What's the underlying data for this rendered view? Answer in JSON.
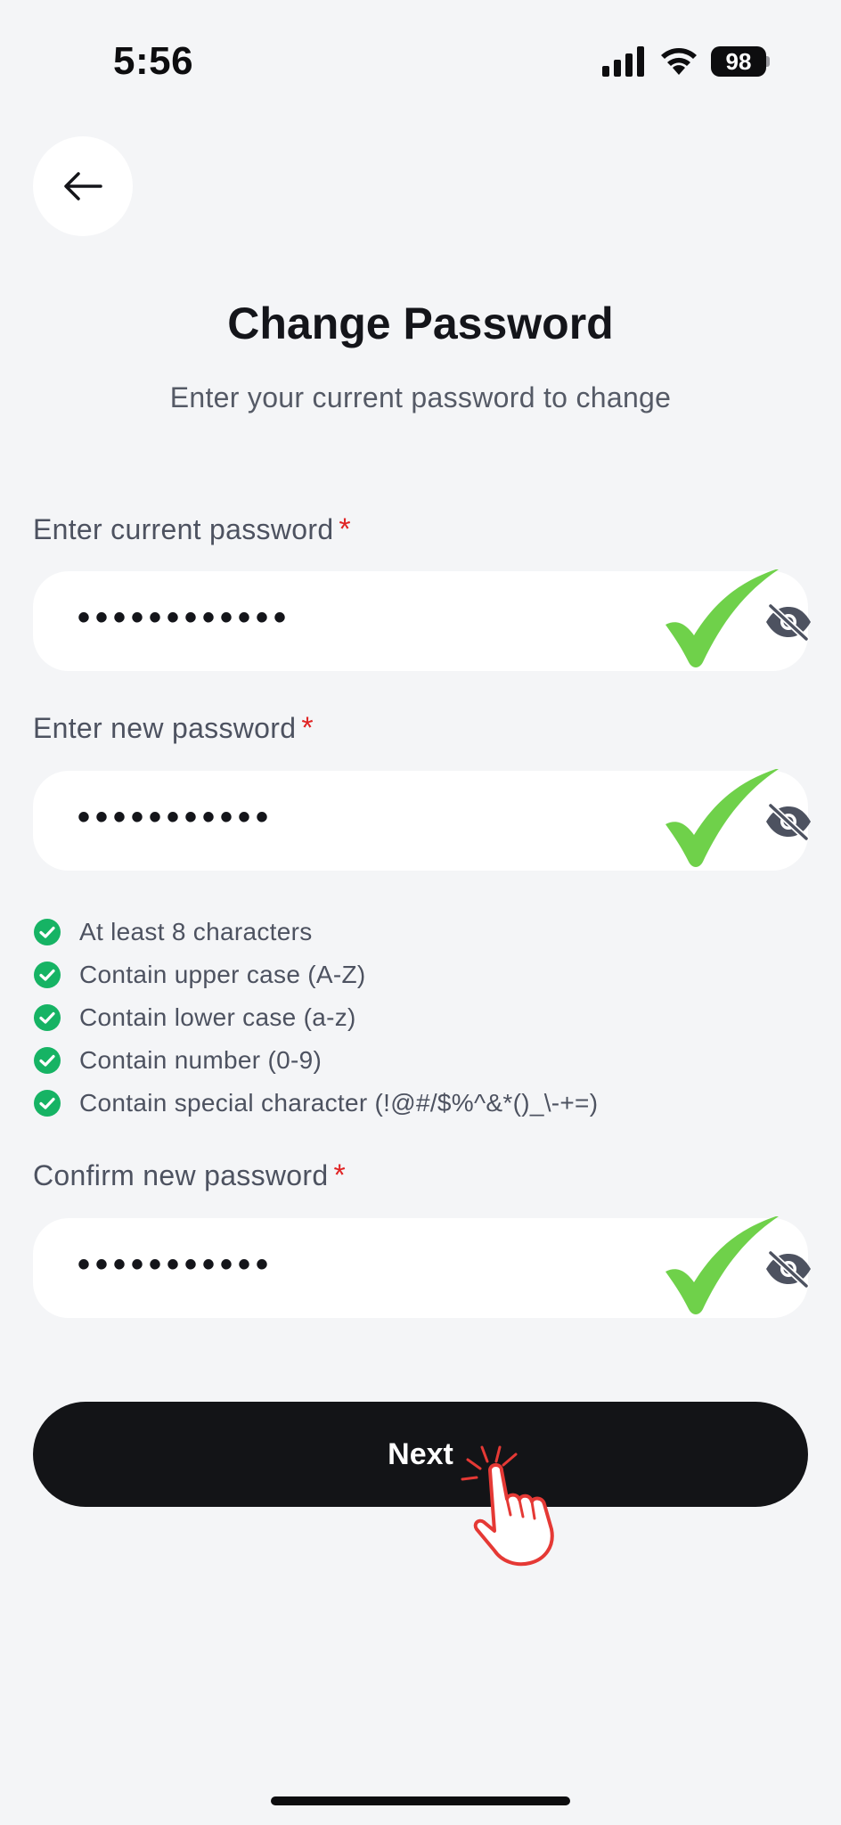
{
  "status_bar": {
    "time": "5:56",
    "battery": "98"
  },
  "header": {
    "back_icon": "arrow-left-icon",
    "title": "Change Password",
    "subtitle": "Enter your current password to change"
  },
  "fields": [
    {
      "label": "Enter current password",
      "required_mark": "*",
      "value": "••••••••••••",
      "toggle_icon": "eye-off-icon",
      "valid": true
    },
    {
      "label": "Enter new password",
      "required_mark": "*",
      "value": "•••••••••••",
      "toggle_icon": "eye-off-icon",
      "valid": true
    },
    {
      "label": "Confirm new password",
      "required_mark": "*",
      "value": "•••••••••••",
      "toggle_icon": "eye-off-icon",
      "valid": true
    }
  ],
  "requirements": [
    {
      "text": "At least 8 characters",
      "met": true
    },
    {
      "text": "Contain upper case (A-Z)",
      "met": true
    },
    {
      "text": "Contain lower case (a-z)",
      "met": true
    },
    {
      "text": "Contain number (0-9)",
      "met": true
    },
    {
      "text": "Contain special character (!@#/$%^&*()_\\-+=)",
      "met": true
    }
  ],
  "next_button": {
    "label": "Next"
  },
  "colors": {
    "background": "#f4f5f7",
    "button_dark": "#131417",
    "required": "#e02424",
    "check_green": "#16b364",
    "overlay_check": "#6fd14a",
    "tap_hand": "#e53935"
  }
}
